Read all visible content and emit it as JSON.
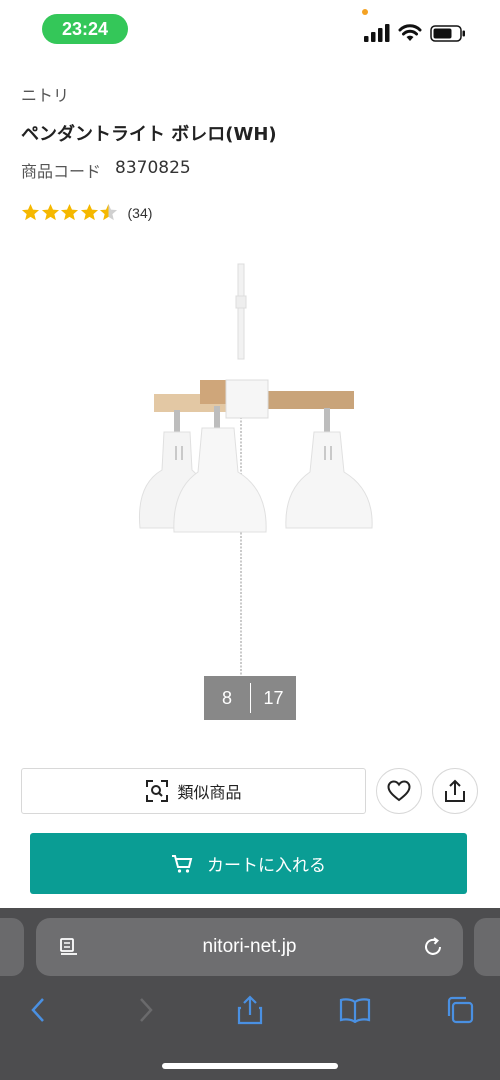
{
  "status_bar": {
    "time": "23:24"
  },
  "product": {
    "brand": "ニトリ",
    "title": "ペンダントライト ボレロ(WH)",
    "code_label": "商品コード",
    "code_value": "8370825",
    "rating": 4.5,
    "review_count": "(34)"
  },
  "gallery": {
    "current": "8",
    "total": "17"
  },
  "actions": {
    "similar_label": "類似商品",
    "favorite_icon": "heart-icon",
    "share_icon": "share-icon",
    "cart_label": "カートに入れる"
  },
  "browser": {
    "url": "nitori-net.jp"
  },
  "colors": {
    "accent": "#0a9d94",
    "star": "#f5b800",
    "status_pill": "#34c759"
  }
}
